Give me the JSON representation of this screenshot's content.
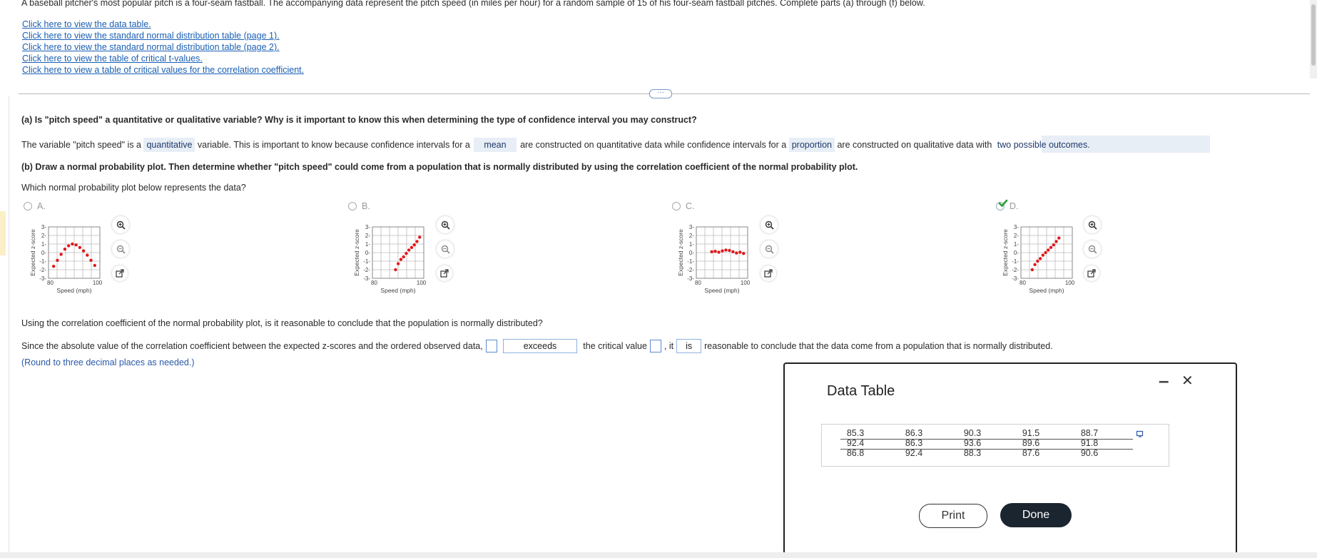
{
  "problem": {
    "intro": "A baseball pitcher's most popular pitch is a four-seam fastball. The accompanying data represent the pitch speed (in miles per hour) for a random sample of 15 of his four-seam fastball pitches. Complete parts (a) through (f) below.",
    "links": [
      "Click here to view the data table.",
      "Click here to view the standard normal distribution table (page 1).",
      "Click here to view the standard normal distribution table (page 2).",
      "Click here to view the table of critical t-values.",
      "Click here to view a table of critical values for the correlation coefficient."
    ]
  },
  "part_a": {
    "question": "(a) Is \"pitch speed\" a quantitative or qualitative variable? Why is it important to know this when determining the type of confidence interval you may construct?",
    "s1": "The variable \"pitch speed\" is a",
    "a1": "quantitative",
    "s2": "variable. This is important to know because confidence intervals for a",
    "a2": "mean",
    "s3": "are constructed on quantitative data while confidence intervals for a",
    "a3": "proportion",
    "s4": "are constructed on qualitative data with",
    "a4": "two possible outcomes."
  },
  "part_b": {
    "question": "(b) Draw a normal probability plot. Then determine whether \"pitch speed\" could come from a population that is normally distributed by using the correlation coefficient of the normal probability plot.",
    "which": "Which normal probability plot below represents the data?",
    "options": [
      {
        "label": "A.",
        "selected": false
      },
      {
        "label": "B.",
        "selected": false
      },
      {
        "label": "C.",
        "selected": false
      },
      {
        "label": "D.",
        "selected": true
      }
    ],
    "plot_ylabel": "Expected z-score",
    "plot_xlabel": "Speed (mph)",
    "x_ticks": [
      "80",
      "100"
    ],
    "y_ticks": [
      "3",
      "2",
      "1",
      "0",
      "-1",
      "-2",
      "-3"
    ],
    "q2": "Using the correlation coefficient of the normal probability plot, is it reasonable to conclude that the population is normally distributed?",
    "s1": "Since the absolute value of the correlation coefficient between the expected z-scores and the ordered observed data,",
    "a1": "exceeds",
    "s2": "the critical value",
    "s3": ", it",
    "a2": "is",
    "s4": "reasonable to conclude that the data come from a population that is normally distributed.",
    "round_note": "(Round to three decimal places as needed.)"
  },
  "modal": {
    "title": "Data Table",
    "rows": [
      [
        "85.3",
        "86.3",
        "90.3",
        "91.5",
        "88.7"
      ],
      [
        "92.4",
        "86.3",
        "93.6",
        "89.6",
        "91.8"
      ],
      [
        "86.8",
        "92.4",
        "88.3",
        "87.6",
        "90.6"
      ]
    ],
    "print_label": "Print",
    "done_label": "Done",
    "minimize_glyph": "–",
    "close_glyph": "✕"
  },
  "divider_glyph": "···",
  "colors": {
    "link": "#1a5fb4",
    "answer_bg": "#e8eef6",
    "plot_points": "#e0191b",
    "check": "#2a9d3a",
    "done_bg": "#1b2530"
  }
}
